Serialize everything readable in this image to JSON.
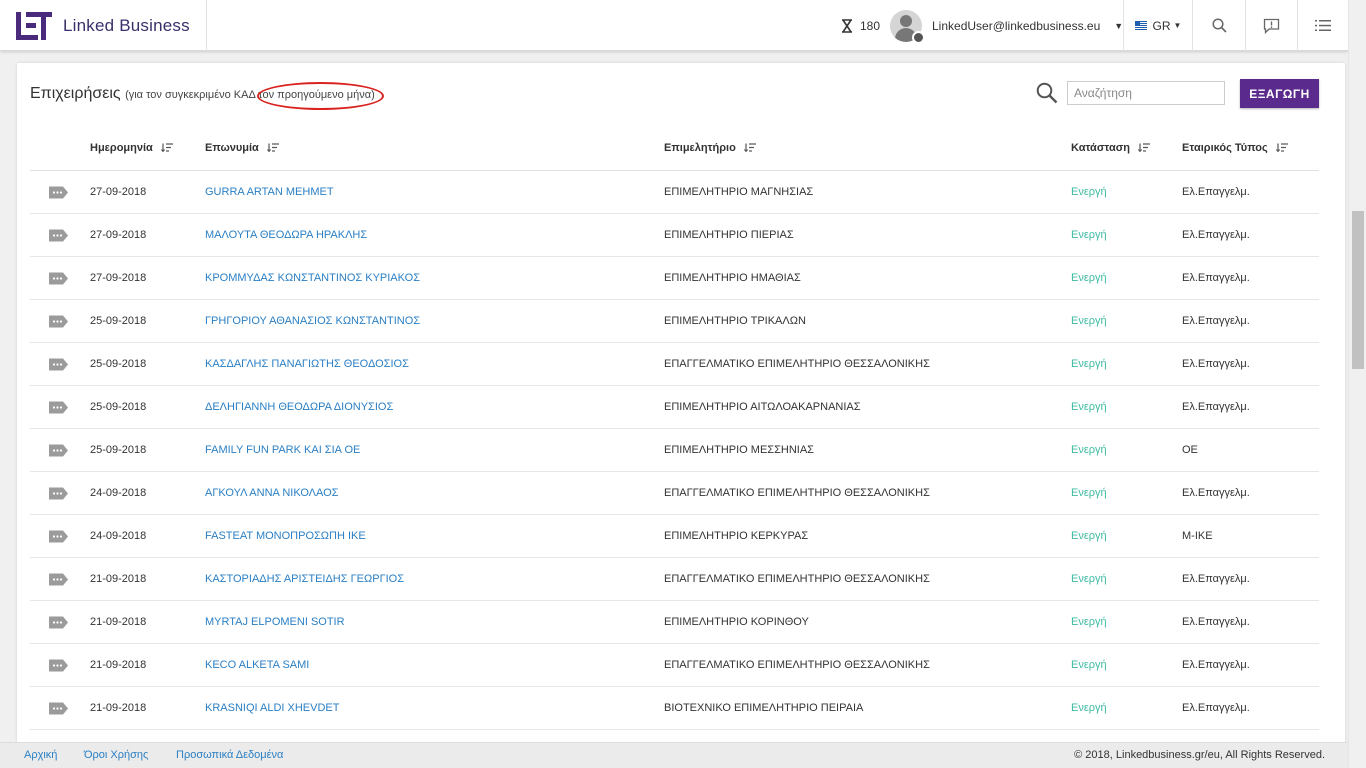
{
  "header": {
    "brand": "Linked Business",
    "credits": "180",
    "user_email": "LinkedUser@linkedbusiness.eu",
    "language": "GR"
  },
  "card": {
    "title": "Επιχειρήσεις",
    "subtitle": "(για τον συγκεκριμένο ΚΑΔ τον προηγούμενο μήνα)",
    "search_placeholder": "Αναζήτηση",
    "export_label": "ΕΞΑΓΩΓΗ"
  },
  "table": {
    "columns": {
      "date": "Ημερομηνία",
      "name": "Επωνυμία",
      "chamber": "Επιμελητήριο",
      "status": "Κατάσταση",
      "type": "Εταιρικός Τύπος"
    },
    "rows": [
      {
        "date": "27-09-2018",
        "name": "GURRA ARTAN MEHMET",
        "chamber": "ΕΠΙΜΕΛΗΤΗΡΙΟ ΜΑΓΝΗΣΙΑΣ",
        "status": "Ενεργή",
        "type": "Ελ.Επαγγελμ."
      },
      {
        "date": "27-09-2018",
        "name": "ΜΑΛΟΥΤΑ ΘΕΟΔΩΡΑ ΗΡΑΚΛΗΣ",
        "chamber": "ΕΠΙΜΕΛΗΤΗΡΙΟ ΠΙΕΡΙΑΣ",
        "status": "Ενεργή",
        "type": "Ελ.Επαγγελμ."
      },
      {
        "date": "27-09-2018",
        "name": "ΚΡΟΜΜΥΔΑΣ ΚΩΝΣΤΑΝΤΙΝΟΣ ΚΥΡΙΑΚΟΣ",
        "chamber": "ΕΠΙΜΕΛΗΤΗΡΙΟ ΗΜΑΘΙΑΣ",
        "status": "Ενεργή",
        "type": "Ελ.Επαγγελμ."
      },
      {
        "date": "25-09-2018",
        "name": "ΓΡΗΓΟΡΙΟΥ ΑΘΑΝΑΣΙΟΣ ΚΩΝΣΤΑΝΤΙΝΟΣ",
        "chamber": "ΕΠΙΜΕΛΗΤΗΡΙΟ ΤΡΙΚΑΛΩΝ",
        "status": "Ενεργή",
        "type": "Ελ.Επαγγελμ."
      },
      {
        "date": "25-09-2018",
        "name": "ΚΑΣΔΑΓΛΗΣ ΠΑΝΑΓΙΩΤΗΣ ΘΕΟΔΟΣΙΟΣ",
        "chamber": "ΕΠΑΓΓΕΛΜΑΤΙΚΟ ΕΠΙΜΕΛΗΤΗΡΙΟ ΘΕΣΣΑΛΟΝΙΚΗΣ",
        "status": "Ενεργή",
        "type": "Ελ.Επαγγελμ."
      },
      {
        "date": "25-09-2018",
        "name": "ΔΕΛΗΓΙΑΝΝΗ ΘΕΟΔΩΡΑ ΔΙΟΝΥΣΙΟΣ",
        "chamber": "ΕΠΙΜΕΛΗΤΗΡΙΟ ΑΙΤΩΛΟΑΚΑΡΝΑΝΙΑΣ",
        "status": "Ενεργή",
        "type": "Ελ.Επαγγελμ."
      },
      {
        "date": "25-09-2018",
        "name": "FAMILY FUN PARK ΚΑΙ ΣΙΑ ΟΕ",
        "chamber": "ΕΠΙΜΕΛΗΤΗΡΙΟ ΜΕΣΣΗΝΙΑΣ",
        "status": "Ενεργή",
        "type": "ΟΕ"
      },
      {
        "date": "24-09-2018",
        "name": "ΑΓΚΟΥΛ ΑΝΝΑ ΝΙΚΟΛΑΟΣ",
        "chamber": "ΕΠΑΓΓΕΛΜΑΤΙΚΟ ΕΠΙΜΕΛΗΤΗΡΙΟ ΘΕΣΣΑΛΟΝΙΚΗΣ",
        "status": "Ενεργή",
        "type": "Ελ.Επαγγελμ."
      },
      {
        "date": "24-09-2018",
        "name": "FASTEAT ΜΟΝΟΠΡΟΣΩΠΗ ΙΚΕ",
        "chamber": "ΕΠΙΜΕΛΗΤΗΡΙΟ ΚΕΡΚΥΡΑΣ",
        "status": "Ενεργή",
        "type": "Μ-ΙΚΕ"
      },
      {
        "date": "21-09-2018",
        "name": "ΚΑΣΤΟΡΙΑΔΗΣ ΑΡΙΣΤΕΙΔΗΣ ΓΕΩΡΓΙΟΣ",
        "chamber": "ΕΠΑΓΓΕΛΜΑΤΙΚΟ ΕΠΙΜΕΛΗΤΗΡΙΟ ΘΕΣΣΑΛΟΝΙΚΗΣ",
        "status": "Ενεργή",
        "type": "Ελ.Επαγγελμ."
      },
      {
        "date": "21-09-2018",
        "name": "MYRTAJ ELPOMENI SOTIR",
        "chamber": "ΕΠΙΜΕΛΗΤΗΡΙΟ ΚΟΡΙΝΘΟΥ",
        "status": "Ενεργή",
        "type": "Ελ.Επαγγελμ."
      },
      {
        "date": "21-09-2018",
        "name": "KECO ALKETA SAMI",
        "chamber": "ΕΠΑΓΓΕΛΜΑΤΙΚΟ ΕΠΙΜΕΛΗΤΗΡΙΟ ΘΕΣΣΑΛΟΝΙΚΗΣ",
        "status": "Ενεργή",
        "type": "Ελ.Επαγγελμ."
      },
      {
        "date": "21-09-2018",
        "name": "KRASNIQI ALDI XHEVDET",
        "chamber": "ΒΙΟΤΕΧΝΙΚΟ ΕΠΙΜΕΛΗΤΗΡΙΟ ΠΕΙΡΑΙΑ",
        "status": "Ενεργή",
        "type": "Ελ.Επαγγελμ."
      }
    ]
  },
  "footer": {
    "home": "Αρχική",
    "terms": "Όροι Χρήσης",
    "privacy": "Προσωπικά Δεδομένα",
    "copyright": "© 2018, Linkedbusiness.gr/eu, All Rights Reserved."
  },
  "icons": {
    "logo": "logo-mark",
    "credits": "hourglass-icon",
    "avatar": "user-avatar",
    "language": "greek-flag-icon",
    "search": "search-icon",
    "feedback": "feedback-icon",
    "menu": "list-menu-icon",
    "sort": "sort-icon",
    "row_action": "tag-icon"
  },
  "colors": {
    "brand": "#5a2b8c",
    "link": "#2a7fc4",
    "status_active": "#3dbba2",
    "highlight": "#d9231f"
  }
}
